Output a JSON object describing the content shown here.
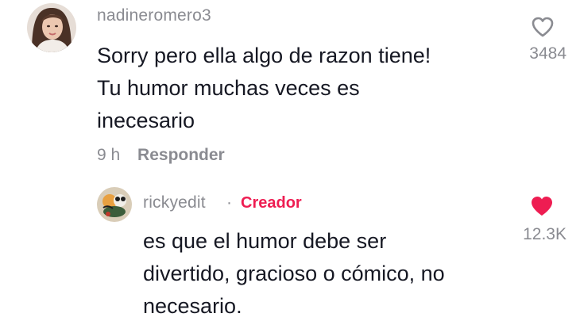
{
  "comment": {
    "username": "nadineromero3",
    "text_lines": [
      "Sorry pero ella algo de razon tiene!",
      "Tu humor muchas veces es",
      "inecesario"
    ],
    "time": "9 h",
    "reply_label": "Responder",
    "like_count": "3484",
    "liked": false,
    "avatar_icon": "user-avatar-photo"
  },
  "reply": {
    "username": "rickyedit",
    "separator": "·",
    "badge": "Creador",
    "text_lines": [
      "es que el humor debe ser",
      "divertido, gracioso o cómico, no",
      "necesario."
    ],
    "like_count": "12.3K",
    "liked": true,
    "avatar_icon": "creator-avatar-photo"
  },
  "colors": {
    "text": "#161823",
    "muted": "#8a8b91",
    "accent": "#ee1d52",
    "background": "#ffffff"
  }
}
